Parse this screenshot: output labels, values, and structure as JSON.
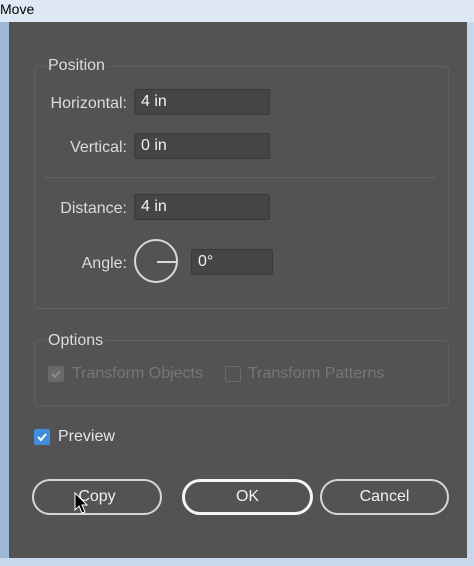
{
  "window": {
    "title": "Move"
  },
  "position": {
    "title": "Position",
    "horizontal": {
      "label": "Horizontal:",
      "value": "4 in"
    },
    "vertical": {
      "label": "Vertical:",
      "value": "0 in"
    },
    "distance": {
      "label": "Distance:",
      "value": "4 in"
    },
    "angle": {
      "label": "Angle:",
      "value": "0°"
    }
  },
  "options": {
    "title": "Options",
    "transform_objects": {
      "label": "Transform Objects",
      "checked": true,
      "enabled": false
    },
    "transform_patterns": {
      "label": "Transform Patterns",
      "checked": false,
      "enabled": false
    }
  },
  "preview": {
    "label": "Preview",
    "checked": true
  },
  "buttons": {
    "copy": "Copy",
    "ok": "OK",
    "cancel": "Cancel"
  },
  "colors": {
    "dialog_bg": "#535353",
    "checkbox_accent": "#3f8ddb"
  },
  "icons": {
    "angle_dial": "angle-dial-icon",
    "cursor": "mouse-pointer-icon"
  }
}
